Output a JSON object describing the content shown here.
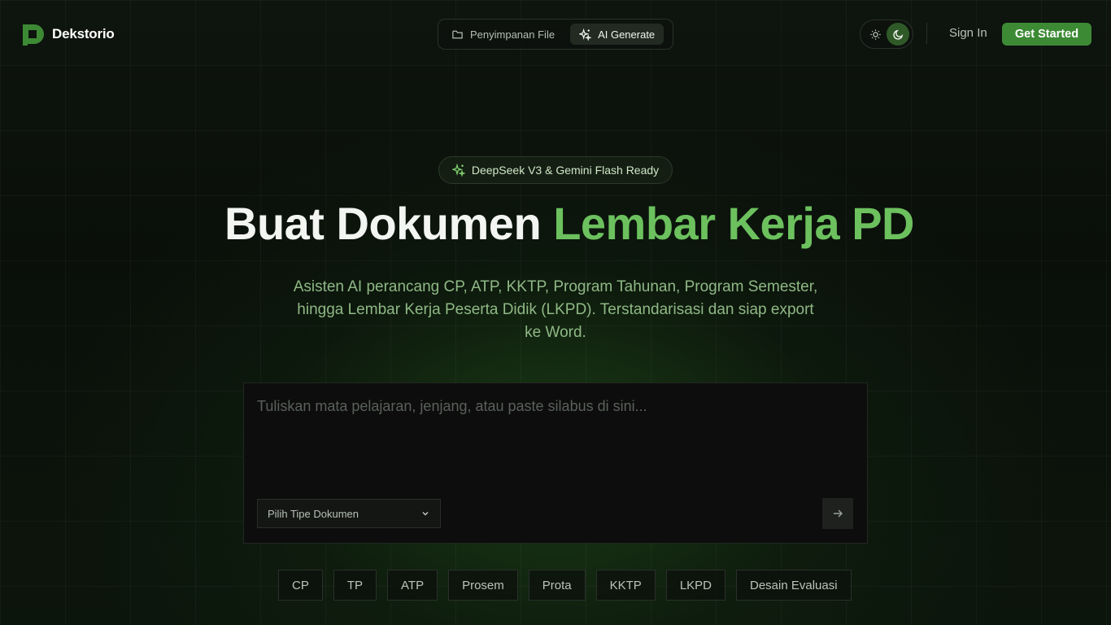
{
  "brand": {
    "name": "Dekstorio",
    "color": "#3d8a35"
  },
  "nav": {
    "items": [
      {
        "label": "Penyimpanan File",
        "icon": "folder-icon",
        "active": false
      },
      {
        "label": "AI Generate",
        "icon": "sparkles-icon",
        "active": true
      }
    ]
  },
  "theme": {
    "light_icon": "sun-icon",
    "dark_icon": "moon-icon",
    "active": "dark"
  },
  "auth": {
    "sign_in": "Sign In",
    "get_started": "Get Started"
  },
  "hero": {
    "badge": "DeepSeek V3 & Gemini Flash Ready",
    "title_main": "Buat Dokumen ",
    "title_accent": "Lembar Kerja PD",
    "subtitle": "Asisten AI perancang CP, ATP, KKTP, Program Tahunan, Program Semester, hingga Lembar Kerja Peserta Didik (LKPD). Terstandarisasi dan siap export ke Word."
  },
  "prompt": {
    "placeholder": "Tuliskan mata pelajaran, jenjang, atau paste silabus di sini...",
    "value": "",
    "select_label": "Pilih Tipe Dokumen",
    "submit_icon": "arrow-right-icon"
  },
  "chips": [
    "CP",
    "TP",
    "ATP",
    "Prosem",
    "Prota",
    "KKTP",
    "LKPD",
    "Desain Evaluasi"
  ],
  "colors": {
    "accent": "#6cc15e",
    "background": "#0b0f0b",
    "button": "#3d8a35"
  }
}
